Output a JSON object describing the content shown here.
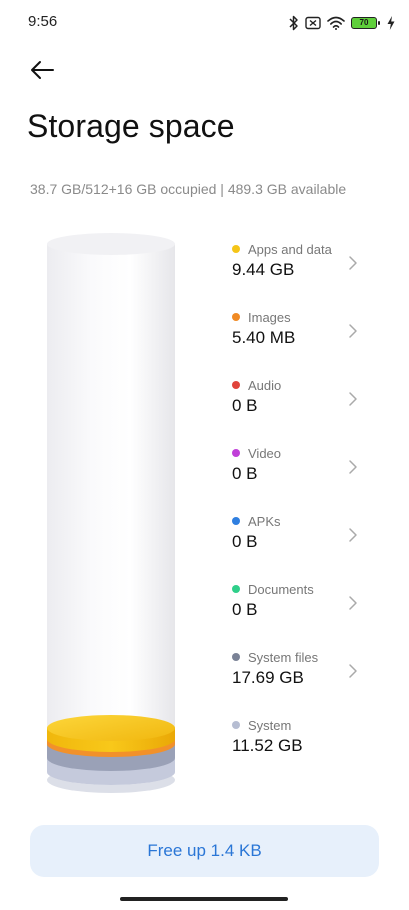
{
  "status_bar": {
    "time": "9:56",
    "battery_level": "70",
    "icons": [
      "bluetooth-icon",
      "mute-icon",
      "wifi-icon",
      "battery-icon",
      "charging-icon"
    ]
  },
  "header": {
    "title": "Storage space"
  },
  "summary": "38.7 GB/512+16 GB occupied | 489.3 GB available",
  "categories": [
    {
      "label": "Apps and data",
      "value": "9.44 GB",
      "color": "#f5c518",
      "has_chevron": true
    },
    {
      "label": "Images",
      "value": "5.40 MB",
      "color": "#f08a24",
      "has_chevron": true
    },
    {
      "label": "Audio",
      "value": "0 B",
      "color": "#e0443b",
      "has_chevron": true
    },
    {
      "label": "Video",
      "value": "0 B",
      "color": "#c03fd8",
      "has_chevron": true
    },
    {
      "label": "APKs",
      "value": "0 B",
      "color": "#2f7fe0",
      "has_chevron": true
    },
    {
      "label": "Documents",
      "value": "0 B",
      "color": "#2fcf8a",
      "has_chevron": true
    },
    {
      "label": "System files",
      "value": "17.69 GB",
      "color": "#7a8296",
      "has_chevron": true
    },
    {
      "label": "System",
      "value": "11.52 GB",
      "color": "#b6bdd2",
      "has_chevron": false
    }
  ],
  "actions": {
    "free_up_label": "Free up 1.4 KB"
  },
  "colors": {
    "accent": "#2a76d6",
    "button_bg": "#e7f0fb"
  }
}
